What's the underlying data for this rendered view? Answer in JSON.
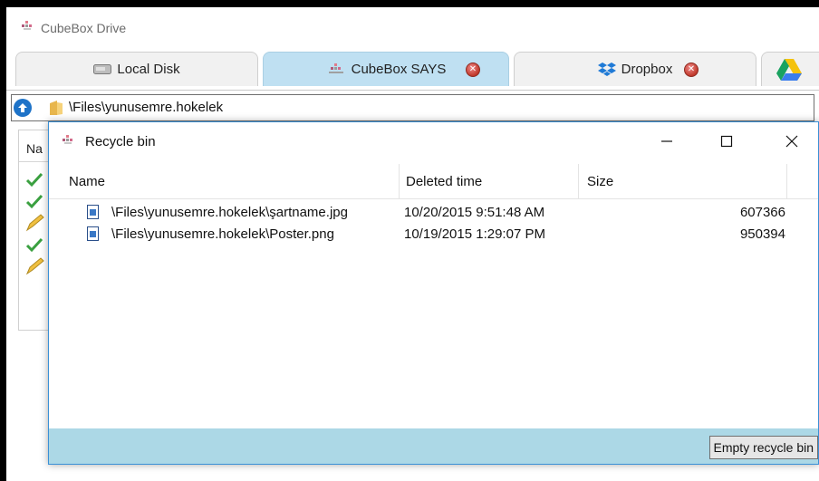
{
  "app": {
    "title": "CubeBox Drive"
  },
  "tabs": [
    {
      "label": "Local Disk",
      "icon": "drive-icon",
      "closable": false,
      "active": false
    },
    {
      "label": "CubeBox SAYS",
      "icon": "cubebox-logo-icon",
      "closable": true,
      "active": true
    },
    {
      "label": "Dropbox",
      "icon": "dropbox-icon",
      "closable": true,
      "active": false
    },
    {
      "label": "",
      "icon": "google-drive-icon",
      "closable": false,
      "active": false
    }
  ],
  "address": {
    "path": "\\Files\\yunusemre.hokelek"
  },
  "background_list": {
    "header": "Na",
    "row_status_icons": [
      "check-icon",
      "check-icon",
      "pencil-icon",
      "check-icon",
      "pencil-icon"
    ]
  },
  "dialog": {
    "title": "Recycle bin",
    "columns": {
      "name": "Name",
      "deleted": "Deleted time",
      "size": "Size"
    },
    "rows": [
      {
        "name": "\\Files\\yunusemre.hokelek\\şartname.jpg",
        "deleted": "10/20/2015 9:51:48 AM",
        "size": "607366"
      },
      {
        "name": "\\Files\\yunusemre.hokelek\\Poster.png",
        "deleted": "10/19/2015 1:29:07 PM",
        "size": "950394"
      }
    ],
    "empty_button": "Empty recycle bin"
  },
  "colors": {
    "active_tab": "#bfe0f2",
    "dialog_footer": "#acd8e6",
    "dialog_border": "#3a90d6",
    "close_badge": "#c0392b"
  }
}
